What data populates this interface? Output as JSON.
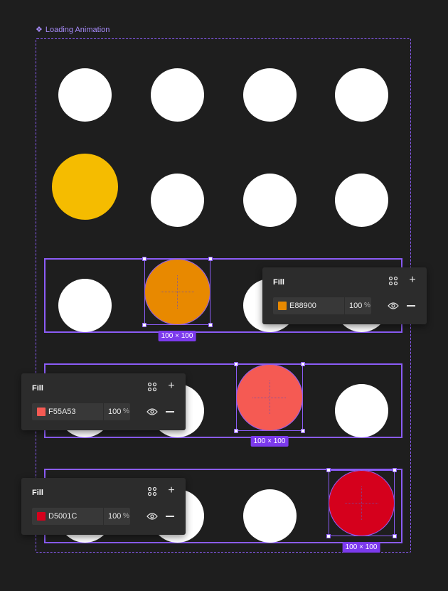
{
  "frame": {
    "label": "Loading Animation",
    "label_icon": "component-icon"
  },
  "colors": {
    "accent": "#8B5CF6",
    "circle_default": "#FFFFFF",
    "yellow_circle": "#F5BC00",
    "orange_circle": "#E88900",
    "coral_circle": "#F55A53",
    "red_circle": "#D5001C"
  },
  "size_tags": [
    "100 × 100",
    "100 × 100",
    "100 × 100"
  ],
  "fill_panels": [
    {
      "title": "Fill",
      "hex": "E88900",
      "color": "#E88900",
      "opacity": "100",
      "unit": "%"
    },
    {
      "title": "Fill",
      "hex": "F55A53",
      "color": "#F55A53",
      "opacity": "100",
      "unit": "%"
    },
    {
      "title": "Fill",
      "hex": "D5001C",
      "color": "#D5001C",
      "opacity": "100",
      "unit": "%"
    }
  ]
}
